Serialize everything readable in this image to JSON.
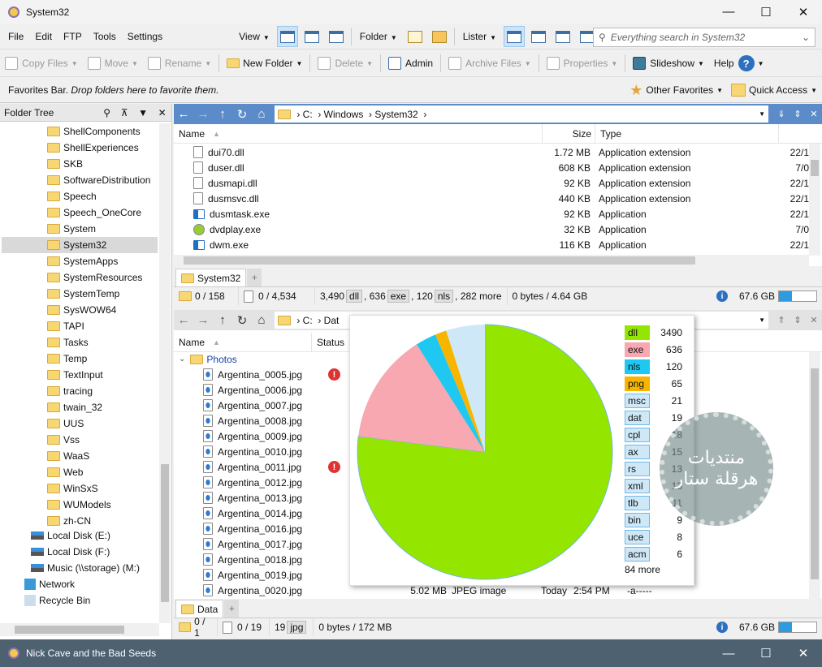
{
  "window": {
    "title": "System32",
    "minimize": "—",
    "maximize": "☐",
    "close": "✕"
  },
  "menu": [
    "File",
    "Edit",
    "FTP",
    "Tools",
    "Settings"
  ],
  "view_menu": {
    "view": "View",
    "folder": "Folder",
    "lister": "Lister"
  },
  "search": {
    "placeholder": "Everything search in System32"
  },
  "toolbar": {
    "copy": "Copy Files",
    "move": "Move",
    "rename": "Rename",
    "new_folder": "New Folder",
    "delete": "Delete",
    "admin": "Admin",
    "archive": "Archive Files",
    "properties": "Properties",
    "slideshow": "Slideshow",
    "help": "Help"
  },
  "favorites": {
    "label": "Favorites Bar.",
    "hint": "Drop folders here to favorite them.",
    "other": "Other Favorites",
    "quick": "Quick Access"
  },
  "tree": {
    "title": "Folder Tree",
    "items": [
      "ShellComponents",
      "ShellExperiences",
      "SKB",
      "SoftwareDistribution",
      "Speech",
      "Speech_OneCore",
      "System",
      "System32",
      "SystemApps",
      "SystemResources",
      "SystemTemp",
      "SysWOW64",
      "TAPI",
      "Tasks",
      "Temp",
      "TextInput",
      "tracing",
      "twain_32",
      "UUS",
      "Vss",
      "WaaS",
      "Web",
      "WinSxS",
      "WUModels",
      "zh-CN"
    ],
    "selected": "System32",
    "drives": [
      "Local Disk (E:)",
      "Local Disk (F:)",
      "Music (\\\\storage) (M:)"
    ],
    "network": "Network",
    "recycle": "Recycle Bin"
  },
  "top_pane": {
    "path": [
      "C:",
      "Windows",
      "System32"
    ],
    "columns": {
      "name": "Name",
      "size": "Size",
      "type": "Type"
    },
    "rows": [
      {
        "name": "dui70.dll",
        "size": "1.72 MB",
        "type": "Application extension",
        "date": "22/1",
        "kind": "dll"
      },
      {
        "name": "duser.dll",
        "size": "608 KB",
        "type": "Application extension",
        "date": "7/0",
        "kind": "dll"
      },
      {
        "name": "dusmapi.dll",
        "size": "92 KB",
        "type": "Application extension",
        "date": "22/1",
        "kind": "dll"
      },
      {
        "name": "dusmsvc.dll",
        "size": "440 KB",
        "type": "Application extension",
        "date": "22/1",
        "kind": "dll"
      },
      {
        "name": "dusmtask.exe",
        "size": "92 KB",
        "type": "Application",
        "date": "22/1",
        "kind": "exe"
      },
      {
        "name": "dvdplay.exe",
        "size": "32 KB",
        "type": "Application",
        "date": "7/0",
        "kind": "dvd"
      },
      {
        "name": "dwm.exe",
        "size": "116 KB",
        "type": "Application",
        "date": "22/1",
        "kind": "exe"
      }
    ],
    "tab": "System32",
    "status": {
      "folders": "0 / 158",
      "files": "0 / 4,534",
      "c1": "3,490",
      "e1": "dll",
      "c2": ", 636",
      "e2": "exe",
      "c3": ", 120",
      "e3": "nls",
      "more": ", 282 more",
      "bytes": "0 bytes / 4.64 GB",
      "free": "67.6 GB",
      "free_fill": 0.35
    }
  },
  "bottom_pane": {
    "path": [
      "C:",
      "Dat"
    ],
    "columns": {
      "name": "Name",
      "status": "Status"
    },
    "folder": "Photos",
    "rows": [
      {
        "name": "Argentina_0005.jpg",
        "warn": true
      },
      {
        "name": "Argentina_0006.jpg"
      },
      {
        "name": "Argentina_0007.jpg"
      },
      {
        "name": "Argentina_0008.jpg"
      },
      {
        "name": "Argentina_0009.jpg"
      },
      {
        "name": "Argentina_0010.jpg"
      },
      {
        "name": "Argentina_0011.jpg",
        "warn": true
      },
      {
        "name": "Argentina_0012.jpg"
      },
      {
        "name": "Argentina_0013.jpg"
      },
      {
        "name": "Argentina_0014.jpg"
      },
      {
        "name": "Argentina_0016.jpg"
      },
      {
        "name": "Argentina_0017.jpg"
      },
      {
        "name": "Argentina_0018.jpg"
      },
      {
        "name": "Argentina_0019.jpg"
      },
      {
        "name": "Argentina_0020.jpg",
        "size": "5.02 MB",
        "type": "JPEG image",
        "date": "Today",
        "time": "2:54 PM",
        "attr": "-a-----"
      }
    ],
    "tab": "Data",
    "status": {
      "folders": "0 / 1",
      "files": "0 / 19",
      "c1": "19",
      "e1": "jpg",
      "bytes": "0 bytes / 172 MB",
      "free": "67.6 GB",
      "free_fill": 0.35
    }
  },
  "chart_data": {
    "type": "pie",
    "categories": [
      "dll",
      "exe",
      "nls",
      "png",
      "msc",
      "dat",
      "cpl",
      "ax",
      "rs",
      "xml",
      "tlb",
      "bin",
      "uce",
      "acm"
    ],
    "values": [
      3490,
      636,
      120,
      65,
      21,
      19,
      18,
      15,
      13,
      13,
      11,
      9,
      8,
      6
    ],
    "more": "84 more",
    "colors": {
      "dll": "#94e600",
      "exe": "#f7a8b0",
      "nls": "#1ec8f0",
      "png": "#f7b500",
      "other": "#cfe8f8"
    }
  },
  "watermark": "منتديات هرقلة ستار",
  "second_window": {
    "title": "Nick Cave and the Bad Seeds"
  }
}
